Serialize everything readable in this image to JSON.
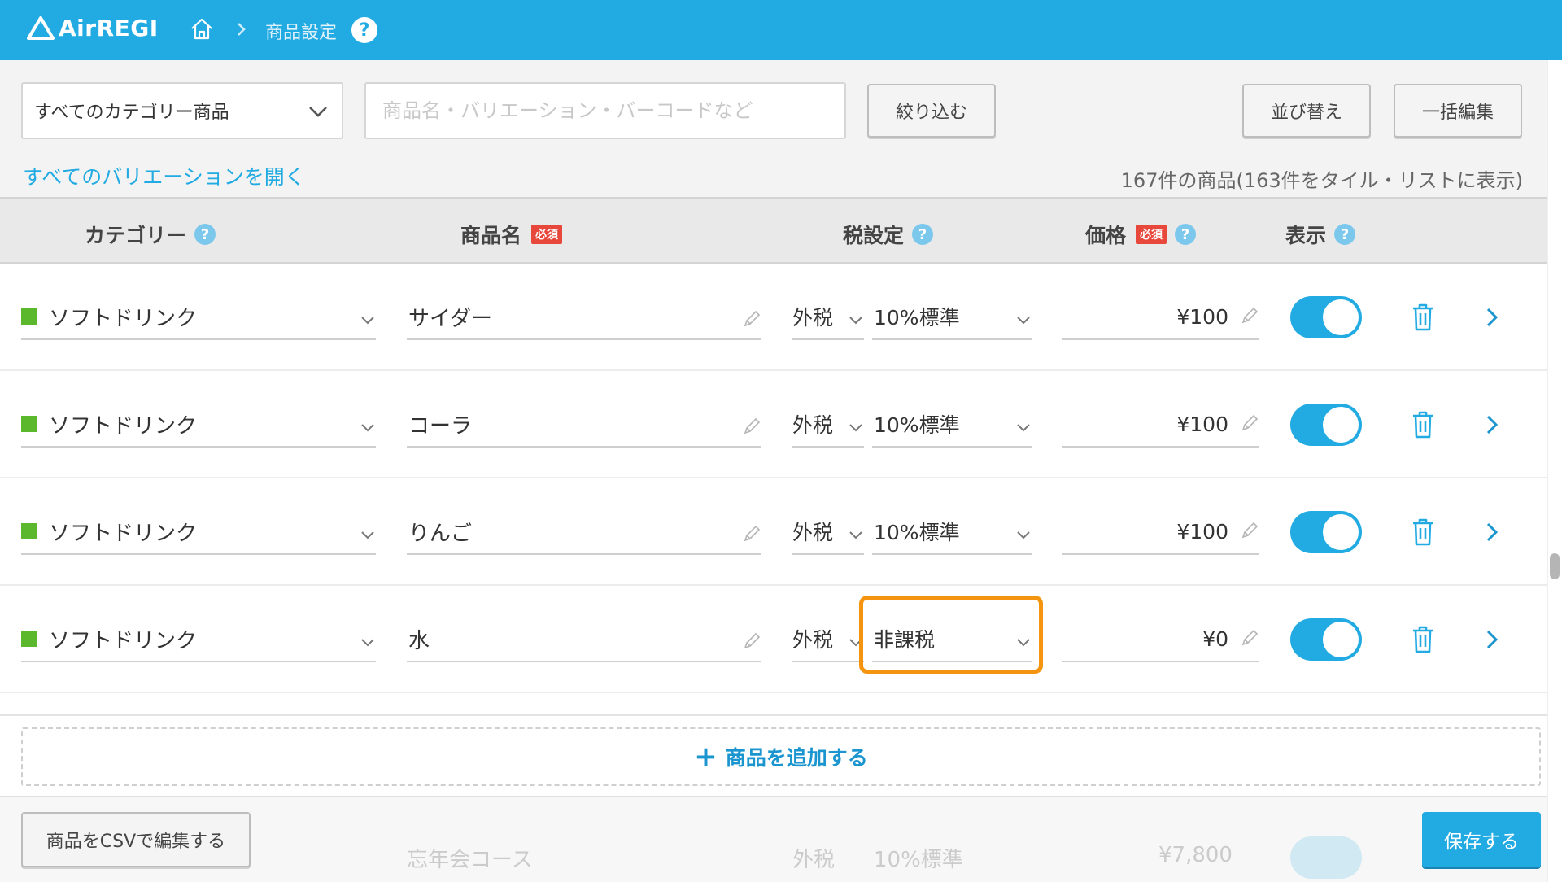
{
  "header": {
    "logo_text": "AirREGI",
    "breadcrumb_current": "商品設定",
    "help_label": "?"
  },
  "toolbar": {
    "category_value": "すべてのカテゴリー商品",
    "search_placeholder": "商品名・バリエーション・バーコードなど",
    "filter_label": "絞り込む",
    "sort_label": "並び替え",
    "bulk_edit_label": "一括編集",
    "expand_all_link": "すべてのバリエーションを開く",
    "count_text": "167件の商品(163件をタイル・リストに表示)"
  },
  "columns": {
    "category": "カテゴリー",
    "name": "商品名",
    "tax": "税設定",
    "price": "価格",
    "display": "表示",
    "required_badge": "必須",
    "help": "?"
  },
  "rows": [
    {
      "category": "ソフトドリンク",
      "name": "サイダー",
      "tax_type": "外税",
      "tax_rate": "10%標準",
      "price": "¥100",
      "display_on": true
    },
    {
      "category": "ソフトドリンク",
      "name": "コーラ",
      "tax_type": "外税",
      "tax_rate": "10%標準",
      "price": "¥100",
      "display_on": true
    },
    {
      "category": "ソフトドリンク",
      "name": "りんご",
      "tax_type": "外税",
      "tax_rate": "10%標準",
      "price": "¥100",
      "display_on": true
    },
    {
      "category": "ソフトドリンク",
      "name": "水",
      "tax_type": "外税",
      "tax_rate": "非課税",
      "price": "¥0",
      "display_on": true
    }
  ],
  "ghost_row": {
    "name": "忘年会コース",
    "tax_type": "外税",
    "tax_rate": "10%標準",
    "price": "¥7,800"
  },
  "add_product": {
    "plus": "+",
    "label": "商品を追加する"
  },
  "footer": {
    "csv_label": "商品をCSVで編集する",
    "save_label": "保存する"
  },
  "colors": {
    "accent": "#22abe2",
    "category_green": "#5bb82c",
    "highlight_orange": "#f5950f",
    "required_red": "#e8473b"
  },
  "icons": [
    "airregi-logo-icon",
    "home-icon",
    "chevron-right-icon",
    "help-icon",
    "chevron-down-icon",
    "pencil-icon",
    "trash-icon",
    "plus-icon"
  ]
}
